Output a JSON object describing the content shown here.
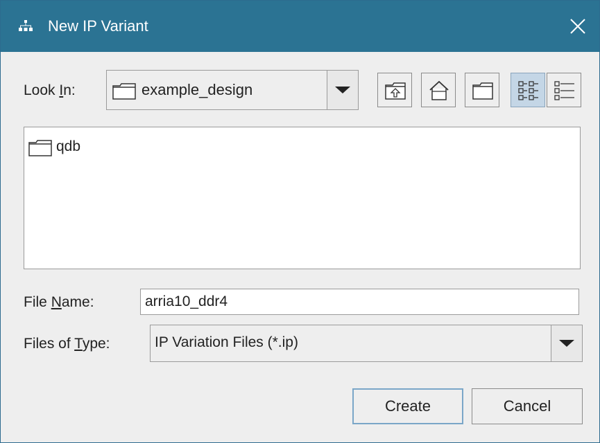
{
  "window": {
    "title": "New IP Variant"
  },
  "icons": {
    "app": "app-network-icon",
    "close": "close-icon",
    "folder": "folder-icon",
    "up": "up-folder-icon",
    "home": "home-icon",
    "new_folder": "new-folder-icon",
    "list_view": "list-view-icon",
    "details_view": "details-view-icon",
    "dropdown": "chevron-down-icon"
  },
  "look_in": {
    "label_pre": "Look ",
    "label_mnemonic": "I",
    "label_post": "n:",
    "value": "example_design"
  },
  "files": [
    {
      "name": "qdb",
      "type": "folder"
    }
  ],
  "file_name": {
    "label_pre": "File ",
    "label_mnemonic": "N",
    "label_post": "ame:",
    "value": "arria10_ddr4"
  },
  "files_of_type": {
    "label_pre": "Files of ",
    "label_mnemonic": "T",
    "label_post": "ype:",
    "value": "IP Variation Files (*.ip)"
  },
  "buttons": {
    "create": "Create",
    "cancel": "Cancel"
  },
  "colors": {
    "titlebar": "#2b7393",
    "background": "#eeeeee",
    "pressed": "#c4d6e6"
  }
}
